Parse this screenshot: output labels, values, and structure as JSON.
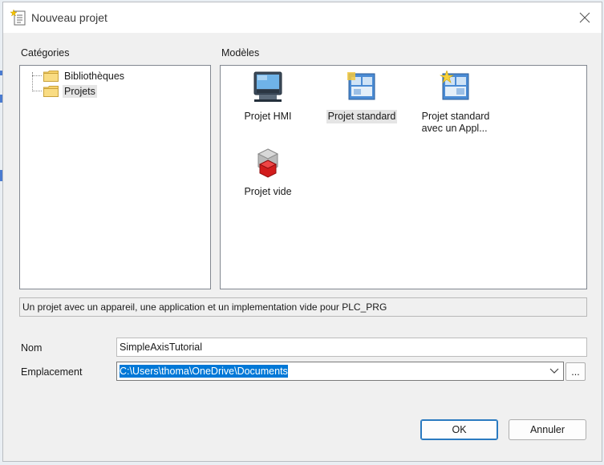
{
  "window": {
    "title": "Nouveau projet",
    "icon": "new-project-document-icon",
    "close_icon": "close-icon"
  },
  "categories": {
    "label": "Catégories",
    "items": [
      {
        "label": "Bibliothèques",
        "icon": "folder-icon",
        "selected": false
      },
      {
        "label": "Projets",
        "icon": "folder-icon",
        "selected": true
      }
    ]
  },
  "templates": {
    "label": "Modèles",
    "items": [
      {
        "label": "Projet HMI",
        "icon": "hmi-project-icon",
        "selected": false
      },
      {
        "label": "Projet standard",
        "icon": "standard-project-icon",
        "selected": true
      },
      {
        "label": "Projet standard avec un Appl...",
        "line1": "Projet standard",
        "line2": "avec un Appl...",
        "icon": "standard-project-app-icon",
        "selected": false
      },
      {
        "label": "Projet vide",
        "icon": "empty-project-icon",
        "selected": false
      }
    ]
  },
  "description": "Un projet avec un appareil, une application et un implementation vide pour PLC_PRG",
  "form": {
    "name_label": "Nom",
    "name_value": "SimpleAxisTutorial",
    "location_label": "Emplacement",
    "location_value": "C:\\Users\\thoma\\OneDrive\\Documents",
    "browse_label": "..."
  },
  "buttons": {
    "ok": "OK",
    "cancel": "Annuler"
  },
  "colors": {
    "selection": "#0078d7",
    "dialog_bg": "#f0f0f0",
    "default_button_border": "#2a7ac0"
  }
}
